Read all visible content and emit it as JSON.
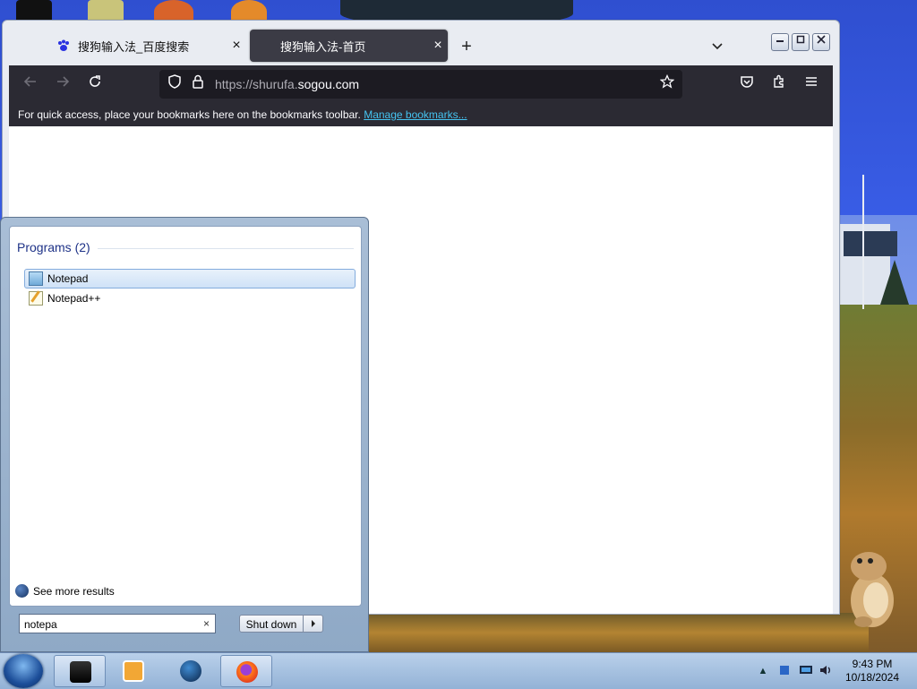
{
  "browser": {
    "tabs": [
      {
        "title": "搜狗输入法_百度搜索",
        "close": "×"
      },
      {
        "title": "搜狗输入法-首页",
        "close": "×"
      }
    ],
    "new_tab": "+",
    "list_tabs": "⌄",
    "url_prefix": "https://shurufa.",
    "url_domain": "sogou.com",
    "bookmarks_message": "For quick access, place your bookmarks here on the bookmarks toolbar.",
    "manage_bookmarks": "Manage bookmarks..."
  },
  "start_menu": {
    "heading": "Programs (2)",
    "items": [
      {
        "label": "Notepad",
        "icon": "notepad-icon",
        "selected": true
      },
      {
        "label": "Notepad++",
        "icon": "notepad-plus-plus-icon",
        "selected": false
      }
    ],
    "see_more": "See more results",
    "search_value": "notepa",
    "search_clear": "×",
    "shutdown_label": "Shut down"
  },
  "taskbar": {
    "time": "9:43 PM",
    "date": "10/18/2024"
  },
  "colors": {
    "accent_link": "#45c3f0",
    "toolbar_dark": "#2b2a33",
    "selected_item": "#cfe2f7"
  }
}
